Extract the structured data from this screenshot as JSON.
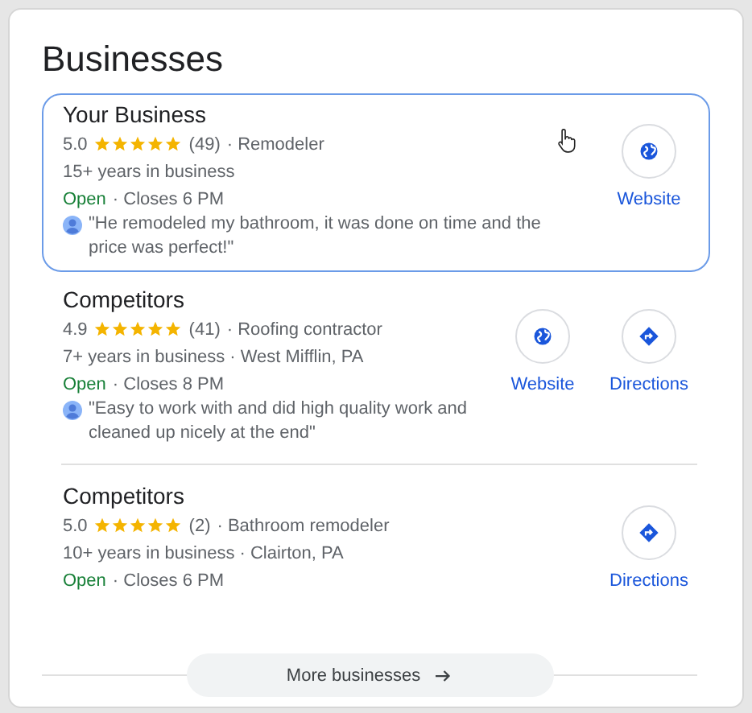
{
  "title": "Businesses",
  "listings": [
    {
      "name": "Your Business",
      "highlighted": true,
      "rating": "5.0",
      "stars": 5,
      "reviews": "(49)",
      "category": "· Remodeler",
      "details": "15+ years in business",
      "status": "Open",
      "hours": "· Closes 6 PM",
      "review": "\"He remodeled my bathroom, it was done on time and the price was perfect!\"",
      "actions": [
        {
          "kind": "website",
          "label": "Website"
        }
      ]
    },
    {
      "name": "Competitors",
      "highlighted": false,
      "rating": "4.9",
      "stars": 5,
      "reviews": "(41)",
      "category": "· Roofing contractor",
      "details": "7+ years in business · West Mifflin, PA",
      "status": "Open",
      "hours": "· Closes 8 PM",
      "review": "\"Easy to work with and did high quality work and cleaned up nicely at the end\"",
      "actions": [
        {
          "kind": "website",
          "label": "Website"
        },
        {
          "kind": "directions",
          "label": "Directions"
        }
      ]
    },
    {
      "name": "Competitors",
      "highlighted": false,
      "rating": "5.0",
      "stars": 5,
      "reviews": "(2)",
      "category": "· Bathroom remodeler",
      "details": "10+ years in business · Clairton, PA",
      "status": "Open",
      "hours": "· Closes 6 PM",
      "actions": [
        {
          "kind": "directions",
          "label": "Directions"
        }
      ]
    }
  ],
  "more_button": "More businesses"
}
